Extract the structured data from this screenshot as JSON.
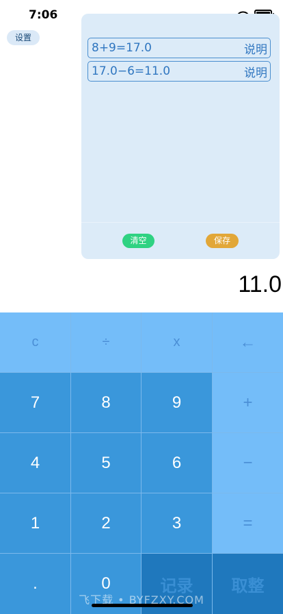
{
  "status_bar": {
    "time": "7:06"
  },
  "settings_label": "设置",
  "history": {
    "items": [
      {
        "expression": "8+9=17.0",
        "action": "说明"
      },
      {
        "expression": "17.0−6=11.0",
        "action": "说明"
      }
    ],
    "clear_label": "清空",
    "save_label": "保存"
  },
  "display": {
    "value": "11.0"
  },
  "keypad": {
    "clear": "c",
    "divide": "÷",
    "multiply": "x",
    "backspace": "←",
    "seven": "7",
    "eight": "8",
    "nine": "9",
    "plus": "+",
    "four": "4",
    "five": "5",
    "six": "6",
    "minus": "−",
    "one": "1",
    "two": "2",
    "three": "3",
    "equals": "=",
    "dot": ".",
    "zero": "0",
    "record": "记录",
    "round": "取整"
  },
  "watermark": "飞下载 • BYFZXY.COM"
}
